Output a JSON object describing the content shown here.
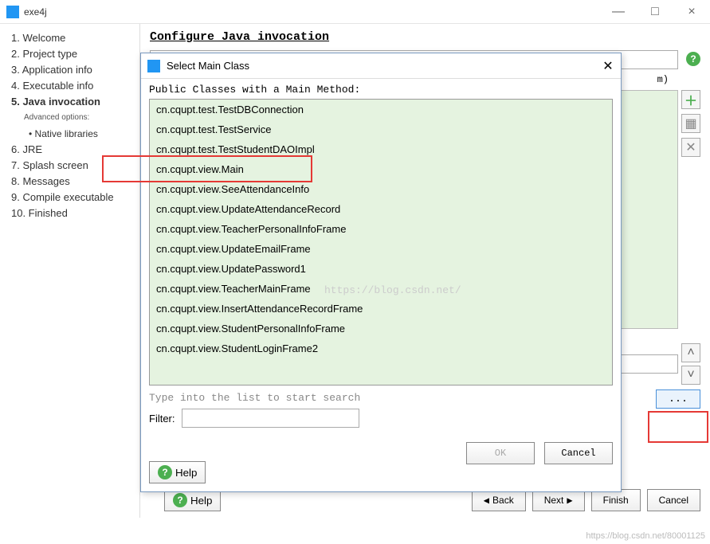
{
  "window": {
    "title": "exe4j",
    "minimize": "—",
    "maximize": "□",
    "close": "×"
  },
  "sidebar": {
    "steps": [
      "1. Welcome",
      "2. Project type",
      "3. Application info",
      "4. Executable info",
      "5. Java invocation",
      "6. JRE",
      "7. Splash screen",
      "8. Messages",
      "9. Compile executable",
      "10. Finished"
    ],
    "advanced_label": "Advanced options:",
    "native_lib": "• Native libraries"
  },
  "content": {
    "heading": "Configure Java invocation",
    "closing_paren": "m)",
    "ellipsis": "...",
    "back": "Back",
    "next": "Next",
    "finish": "Finish",
    "cancel": "Cancel",
    "help": "Help",
    "plus_icon": "＋",
    "x_icon": "✕",
    "up_arrow": "˄",
    "down_arrow": "˅"
  },
  "dialog": {
    "title": "Select Main Class",
    "label": "Public Classes with a Main Method:",
    "items": [
      "cn.cqupt.test.TestDBConnection",
      "cn.cqupt.test.TestService",
      "cn.cqupt.test.TestStudentDAOImpl",
      "cn.cqupt.view.Main",
      "cn.cqupt.view.SeeAttendanceInfo",
      "cn.cqupt.view.UpdateAttendanceRecord",
      "cn.cqupt.view.TeacherPersonalInfoFrame",
      "cn.cqupt.view.UpdateEmailFrame",
      "cn.cqupt.view.UpdatePassword1",
      "cn.cqupt.view.TeacherMainFrame",
      "cn.cqupt.view.InsertAttendanceRecordFrame",
      "cn.cqupt.view.StudentPersonalInfoFrame",
      "cn.cqupt.view.StudentLoginFrame2"
    ],
    "hint": "Type into the list to start search",
    "filter_label": "Filter:",
    "filter_placeholder": "",
    "help": "Help",
    "ok": "OK",
    "cancel": "Cancel"
  },
  "watermark": {
    "center": "https://blog.csdn.net/",
    "corner": "https://blog.csdn.net/80001125"
  }
}
